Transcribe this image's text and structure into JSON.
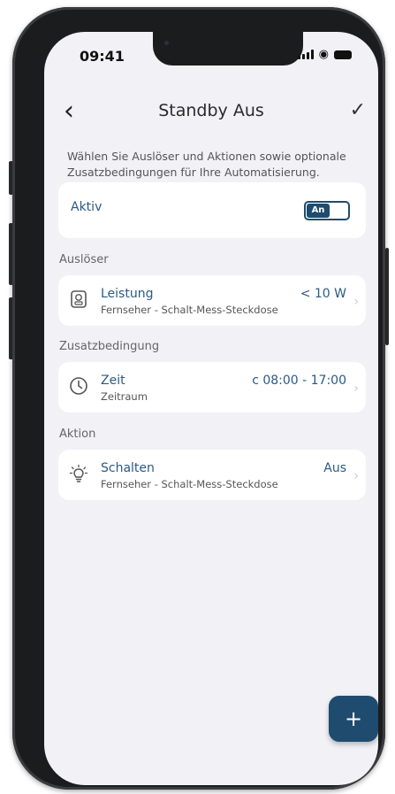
{
  "status_bar": {
    "time": "09:41"
  },
  "header": {
    "title": "Standby Aus"
  },
  "intro_text": "Wählen Sie Auslöser und Aktionen sowie optionale Zusatzbedingungen für Ihre Automatisierung.",
  "active": {
    "label": "Aktiv",
    "toggle_label": "An",
    "is_on": true
  },
  "sections": {
    "trigger": {
      "heading": "Auslöser",
      "title": "Leistung",
      "subtitle": "Fernseher - Schalt-Mess-Steckdose",
      "value": "< 10 W",
      "icon": "power-meter-icon"
    },
    "condition": {
      "heading": "Zusatzbedingung",
      "title": "Zeit",
      "subtitle": "Zeitraum",
      "value": "c 08:00 - 17:00",
      "icon": "clock-icon"
    },
    "action": {
      "heading": "Aktion",
      "title": "Schalten",
      "subtitle": "Fernseher - Schalt-Mess-Steckdose",
      "value": "Aus",
      "icon": "lightbulb-icon"
    }
  },
  "fab": {
    "label": "+"
  },
  "colors": {
    "accent": "#1f4b6e",
    "link": "#2a5a85",
    "background": "#f1f1f6"
  }
}
